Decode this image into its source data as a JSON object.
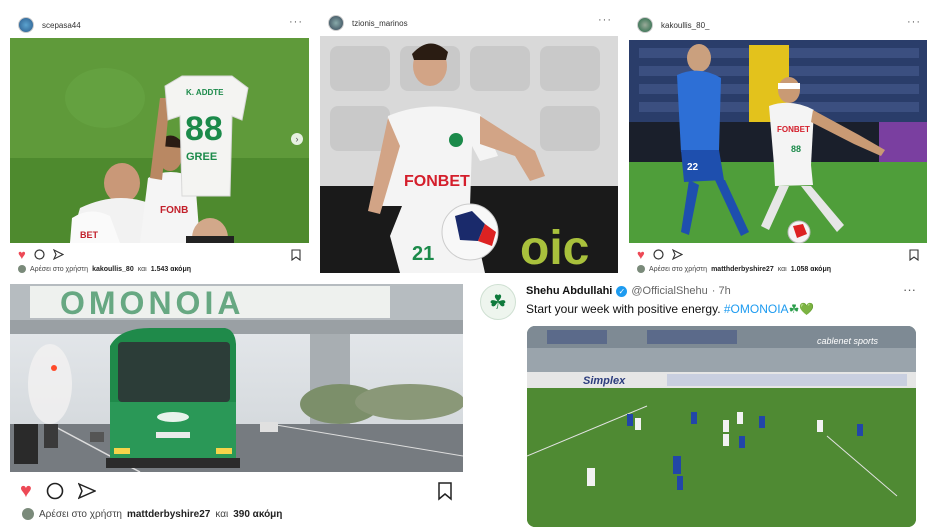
{
  "posts": [
    {
      "username": "scepasa44",
      "likes_prefix": "Αρέσει στο χρήστη",
      "likes_user": "kakoullis_80",
      "likes_mid": "και",
      "likes_count": "1.543 ακόμη"
    },
    {
      "username": "tzionis_marinos"
    },
    {
      "username": "kakoullis_80_",
      "likes_prefix": "Αρέσει στο χρήστη",
      "likes_user": "matthderbyshire27",
      "likes_mid": "και",
      "likes_count": "1.058 ακόμη"
    },
    {
      "likes_prefix": "Αρέσει στο χρήστη",
      "likes_user": "mattderbyshire27",
      "likes_mid": "και",
      "likes_count": "390 ακόμη"
    }
  ],
  "photo_text": {
    "shirt_name": "K. ADDTE",
    "shirt_number": "88",
    "shirt_sponsor": "GREE",
    "jersey_sponsor": "FONBET",
    "shorts_number": "21",
    "banner": "OMONOIA",
    "board": "oic",
    "player2_sponsor": "FONBET",
    "player2_number": "88",
    "player1_number": "22"
  },
  "tweet": {
    "name": "Shehu Abdullahi",
    "handle": "@OfficialShehu",
    "time": "· 7h",
    "text": "Start your week with positive energy.",
    "hashtag": "#OMONOIA",
    "emoji": "☘💚",
    "board1": "Simplex",
    "board2": "cablenet sports"
  },
  "colors": {
    "like_red": "#ed4956",
    "tweet_blue": "#1d9bf0",
    "omonoia_green": "#0f7a3c"
  }
}
